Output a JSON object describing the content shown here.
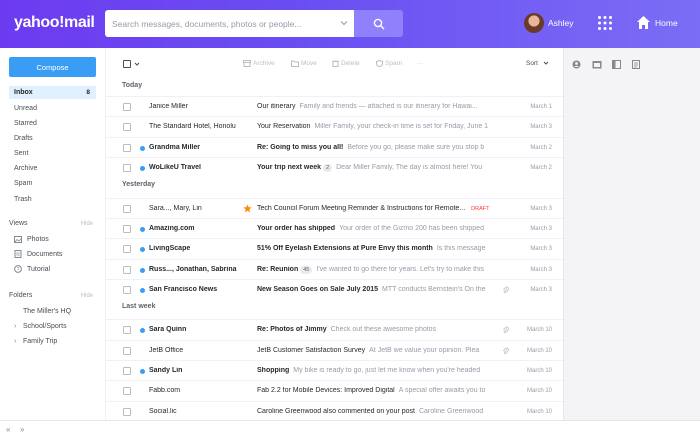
{
  "header": {
    "logo_text": "yahoo!mail",
    "search_placeholder": "Search messages, documents, photos or people...",
    "user_name": "Ashley",
    "home_label": "Home"
  },
  "sidebar": {
    "compose_label": "Compose",
    "folders_primary": [
      {
        "label": "Inbox",
        "count": "8",
        "active": true
      },
      {
        "label": "Unread",
        "count": "",
        "active": false
      },
      {
        "label": "Starred",
        "count": "",
        "active": false
      },
      {
        "label": "Drafts",
        "count": "",
        "active": false
      },
      {
        "label": "Sent",
        "count": "",
        "active": false
      },
      {
        "label": "Archive",
        "count": "",
        "active": false
      },
      {
        "label": "Spam",
        "count": "",
        "active": false
      },
      {
        "label": "Trash",
        "count": "",
        "active": false
      }
    ],
    "views_label": "Views",
    "views_hide": "Hide",
    "views": [
      {
        "label": "Photos",
        "icon": "photo-icon"
      },
      {
        "label": "Documents",
        "icon": "document-icon"
      },
      {
        "label": "Tutorial",
        "icon": "help-icon"
      }
    ],
    "folders_label": "Folders",
    "folders_hide": "Hide",
    "folders": [
      {
        "label": "The Miller's HQ",
        "expandable": false
      },
      {
        "label": "School/Sports",
        "expandable": true
      },
      {
        "label": "Family Trip",
        "expandable": true
      }
    ]
  },
  "toolbar": {
    "archive": "Archive",
    "move": "Move",
    "delete": "Delete",
    "spam": "Spam",
    "more": "···",
    "sort": "Sort"
  },
  "groups": [
    {
      "label": "Today"
    },
    {
      "label": "Yesterday"
    },
    {
      "label": "Last week"
    }
  ],
  "messages": [
    {
      "sender": "Janice Miller",
      "subject": "Our itinerary",
      "snippet": "Family and friends — attached is our itinerary for Hawai...",
      "date": "March 1",
      "unread": false,
      "star": false,
      "clip": false,
      "badge": "",
      "draft": ""
    },
    {
      "sender": "The Standard Hotel, Honolu",
      "subject": "Your Reservation",
      "snippet": "Miller Family, your check-in time is set for Friday, June 1",
      "date": "March 3",
      "unread": false,
      "star": false,
      "clip": false,
      "badge": "",
      "draft": ""
    },
    {
      "sender": "Grandma Miller",
      "subject": "Re: Going to miss you all!",
      "snippet": "Before you go, please make sure you stop b",
      "date": "March 2",
      "unread": true,
      "star": false,
      "clip": false,
      "badge": "",
      "draft": ""
    },
    {
      "sender": "WoLikeU Travel",
      "subject": "Your trip next week",
      "snippet": "Dear Miller Family, The day is almost here! You",
      "date": "March 2",
      "unread": true,
      "star": false,
      "clip": false,
      "badge": "2",
      "draft": ""
    },
    {
      "sender": "Sara..., Mary, Lin",
      "subject": "Tech Council Forum Meeting Reminder & Instructions for Remote...",
      "snippet": "",
      "date": "March 3",
      "unread": false,
      "star": true,
      "clip": false,
      "badge": "",
      "draft": "DRAFT"
    },
    {
      "sender": "Amazing.com",
      "subject": "Your order has shipped",
      "snippet": "Your order of the Gizmo 200 has been shipped",
      "date": "March 3",
      "unread": true,
      "star": false,
      "clip": false,
      "badge": "",
      "draft": ""
    },
    {
      "sender": "LivingScape",
      "subject": "51% Off Eyelash Extensions at Pure Envy this month",
      "snippet": "Is this message",
      "date": "March 3",
      "unread": true,
      "star": false,
      "clip": false,
      "badge": "",
      "draft": ""
    },
    {
      "sender": "Russ..., Jonathan, Sabrina",
      "subject": "Re: Reunion",
      "snippet": "I've wanted to go there for years. Let's try to make this",
      "date": "March 3",
      "unread": true,
      "star": false,
      "clip": false,
      "badge": "45",
      "draft": ""
    },
    {
      "sender": "San Francisco News",
      "subject": "New Season Goes on Sale July 2015",
      "snippet": "MTT conducts Bernstein's On the",
      "date": "March 3",
      "unread": true,
      "star": false,
      "clip": true,
      "badge": "",
      "draft": ""
    },
    {
      "sender": "Sara Quinn",
      "subject": "Re: Photos of Jimmy",
      "snippet": "Check out these awesome photos",
      "date": "March 10",
      "unread": true,
      "star": false,
      "clip": true,
      "badge": "",
      "draft": ""
    },
    {
      "sender": "JetB Office",
      "subject": "JetB Customer Satisfaction Survey",
      "snippet": "At JetB we value your opinion. Plea",
      "date": "March 10",
      "unread": false,
      "star": false,
      "clip": true,
      "badge": "",
      "draft": ""
    },
    {
      "sender": "Sandy Lin",
      "subject": "Shopping",
      "snippet": "My bike is ready to go, just let me know when you're headed",
      "date": "March 10",
      "unread": true,
      "star": false,
      "clip": false,
      "badge": "",
      "draft": ""
    },
    {
      "sender": "Fabb.com",
      "subject": "Fab 2.2 for Mobile Devices: Improved Digital",
      "snippet": "A special offer awaits you to",
      "date": "March 10",
      "unread": false,
      "star": false,
      "clip": false,
      "badge": "",
      "draft": ""
    },
    {
      "sender": "Social.lic",
      "subject": "Caroline Greenwood also commented on your post",
      "snippet": "Caroline Greenwood",
      "date": "March 10",
      "unread": false,
      "star": false,
      "clip": false,
      "badge": "",
      "draft": ""
    }
  ],
  "colors": {
    "header_start": "#6c3bf0",
    "header_end": "#7b6df5",
    "accent_blue": "#3a9df5",
    "star": "#ff8a00",
    "draft": "#ff333a"
  }
}
